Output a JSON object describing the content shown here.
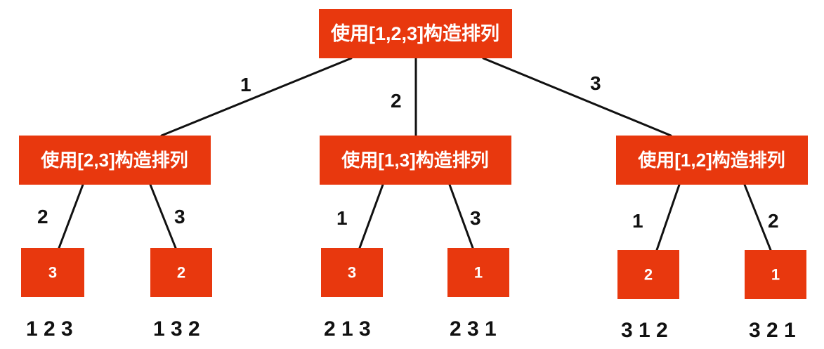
{
  "colors": {
    "node_fill": "#e8380e",
    "node_text": "#ffffff",
    "edge": "#111111",
    "label": "#111111"
  },
  "root": {
    "label": "使用[1,2,3]构造排列"
  },
  "level1": [
    {
      "edge_label": "1",
      "label": "使用[2,3]构造排列"
    },
    {
      "edge_label": "2",
      "label": "使用[1,3]构造排列"
    },
    {
      "edge_label": "3",
      "label": "使用[1,2]构造排列"
    }
  ],
  "leaves": [
    {
      "edge_label": "2",
      "label": "3",
      "result": "1 2 3"
    },
    {
      "edge_label": "3",
      "label": "2",
      "result": "1 3 2"
    },
    {
      "edge_label": "1",
      "label": "3",
      "result": "2 1 3"
    },
    {
      "edge_label": "3",
      "label": "1",
      "result": "2 3 1"
    },
    {
      "edge_label": "1",
      "label": "2",
      "result": "3 1 2"
    },
    {
      "edge_label": "2",
      "label": "1",
      "result": "3 2 1"
    }
  ]
}
